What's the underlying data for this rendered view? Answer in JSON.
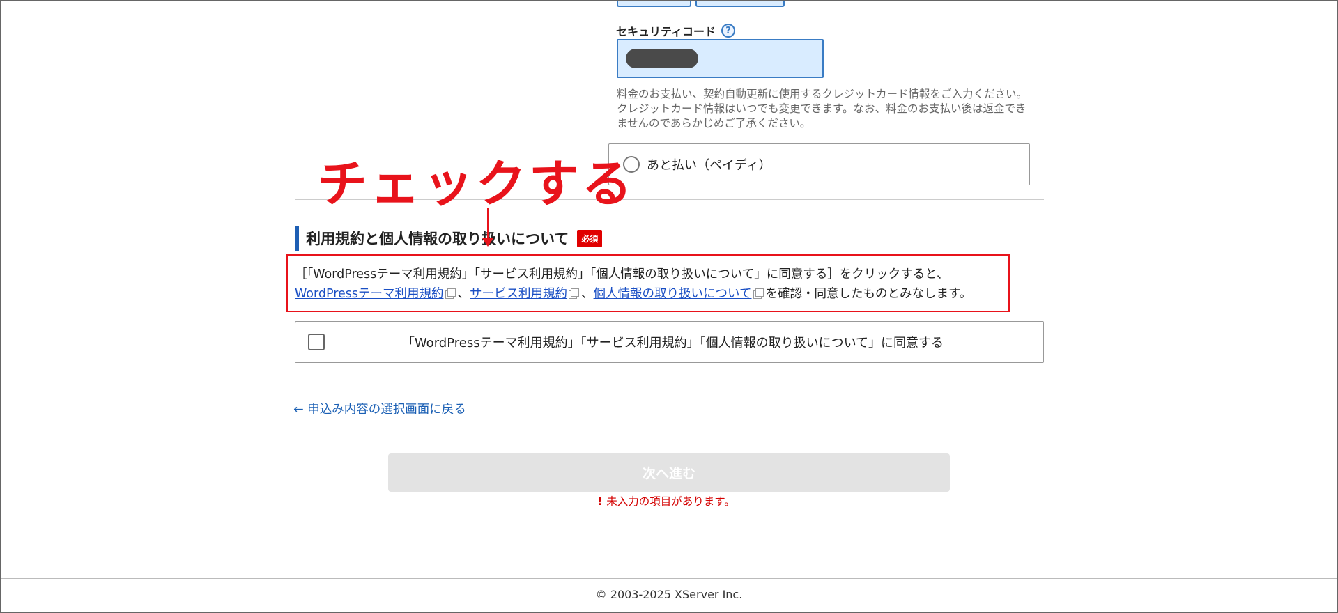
{
  "security": {
    "label": "セキュリティコード",
    "help_icon": "?"
  },
  "payment_note": "料金のお支払い、契約自動更新に使用するクレジットカード情報をご入力ください。クレジットカード情報はいつでも変更できます。なお、料金のお支払い後は返金できませんのであらかじめご了承ください。",
  "payment_option": {
    "label": "あと払い（ペイディ）"
  },
  "annotation": {
    "text": "チェックする",
    "color": "#e8131b"
  },
  "terms": {
    "title": "利用規約と個人情報の取り扱いについて",
    "required": "必須",
    "intro": "［「WordPressテーマ利用規約」「サービス利用規約」「個人情報の取り扱いについて」に同意する］をクリックすると、",
    "links": [
      "WordPressテーマ利用規約",
      "サービス利用規約",
      "個人情報の取り扱いについて"
    ],
    "separator": "、",
    "outro": "を確認・同意したものとみなします。",
    "agree_label": "「WordPressテーマ利用規約」「サービス利用規約」「個人情報の取り扱いについて」に同意する"
  },
  "navigation": {
    "back_link": "← 申込み内容の選択画面に戻る",
    "next_button": "次へ進む",
    "error_icon": "!",
    "error_message": "未入力の項目があります。"
  },
  "footer": {
    "copyright": "© 2003-2025 XServer Inc."
  },
  "colors": {
    "accent": "#1e5fb4",
    "link": "#1a4fc4",
    "error": "#d40000",
    "required_badge": "#e00000"
  }
}
